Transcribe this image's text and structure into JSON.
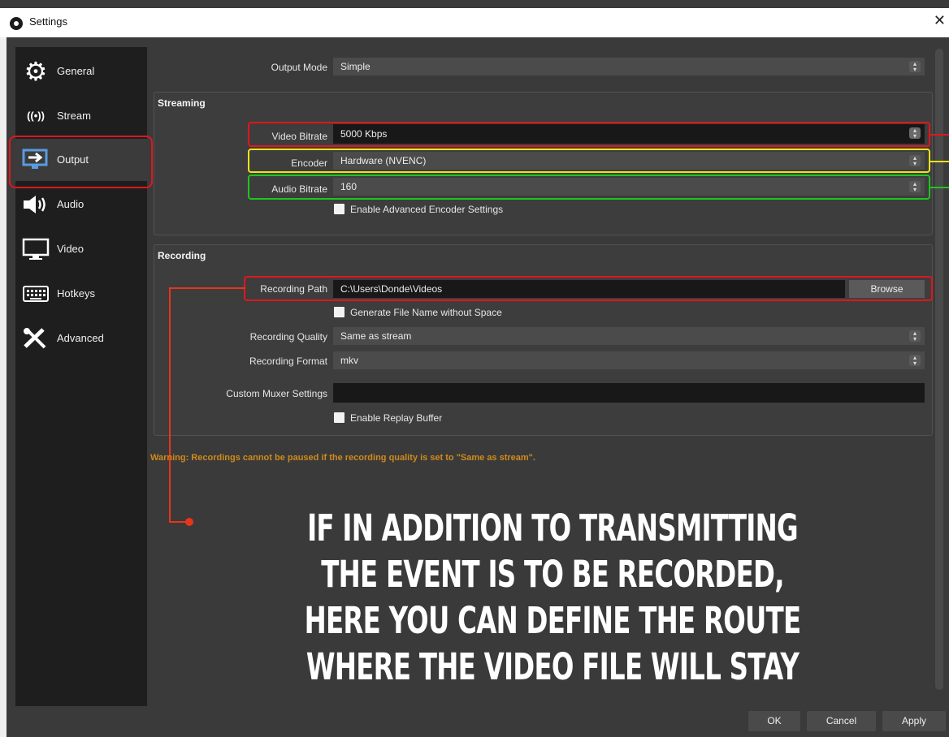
{
  "window": {
    "title": "Settings",
    "close_glyph": "✕",
    "app_icon": "obs-logo-icon"
  },
  "sidebar": {
    "items": [
      {
        "label": "General",
        "icon": "gear-icon",
        "glyph": "⚙"
      },
      {
        "label": "Stream",
        "icon": "antenna-icon",
        "glyph": "((•))"
      },
      {
        "label": "Output",
        "icon": "output-monitor-icon",
        "glyph": "⇨"
      },
      {
        "label": "Audio",
        "icon": "speaker-icon",
        "glyph": "🔈"
      },
      {
        "label": "Video",
        "icon": "monitor-icon",
        "glyph": "▭"
      },
      {
        "label": "Hotkeys",
        "icon": "keyboard-icon",
        "glyph": "⌨"
      },
      {
        "label": "Advanced",
        "icon": "tools-icon",
        "glyph": "✖"
      }
    ],
    "selected": "Output"
  },
  "output_mode": {
    "label": "Output Mode",
    "value": "Simple"
  },
  "streaming": {
    "title": "Streaming",
    "video_bitrate": {
      "label": "Video Bitrate",
      "value": "5000 Kbps"
    },
    "encoder": {
      "label": "Encoder",
      "value": "Hardware (NVENC)"
    },
    "audio_bitrate": {
      "label": "Audio Bitrate",
      "value": "160"
    },
    "advanced_encoder": {
      "label": "Enable Advanced Encoder Settings",
      "checked": false
    }
  },
  "recording": {
    "title": "Recording",
    "path": {
      "label": "Recording Path",
      "value": "C:\\Users\\Donde\\Videos",
      "browse_label": "Browse"
    },
    "no_space": {
      "label": "Generate File Name without Space",
      "checked": false
    },
    "quality": {
      "label": "Recording Quality",
      "value": "Same as stream"
    },
    "format": {
      "label": "Recording Format",
      "value": "mkv"
    },
    "muxer": {
      "label": "Custom Muxer Settings",
      "value": ""
    },
    "replay_buffer": {
      "label": "Enable Replay Buffer",
      "checked": false
    }
  },
  "warning": "Warning: Recordings cannot be paused if the recording quality is set to \"Same as stream\".",
  "caption": "If in addition to transmitting the event is to be recorded, here you can define the route where the video file will stay",
  "footer": {
    "ok": "OK",
    "cancel": "Cancel",
    "apply": "Apply"
  },
  "colors": {
    "highlight_red": "#e0161e",
    "highlight_yellow": "#f2e21a",
    "highlight_green": "#1ec51e",
    "warning": "#d08a1a",
    "callout": "#e8351a"
  }
}
